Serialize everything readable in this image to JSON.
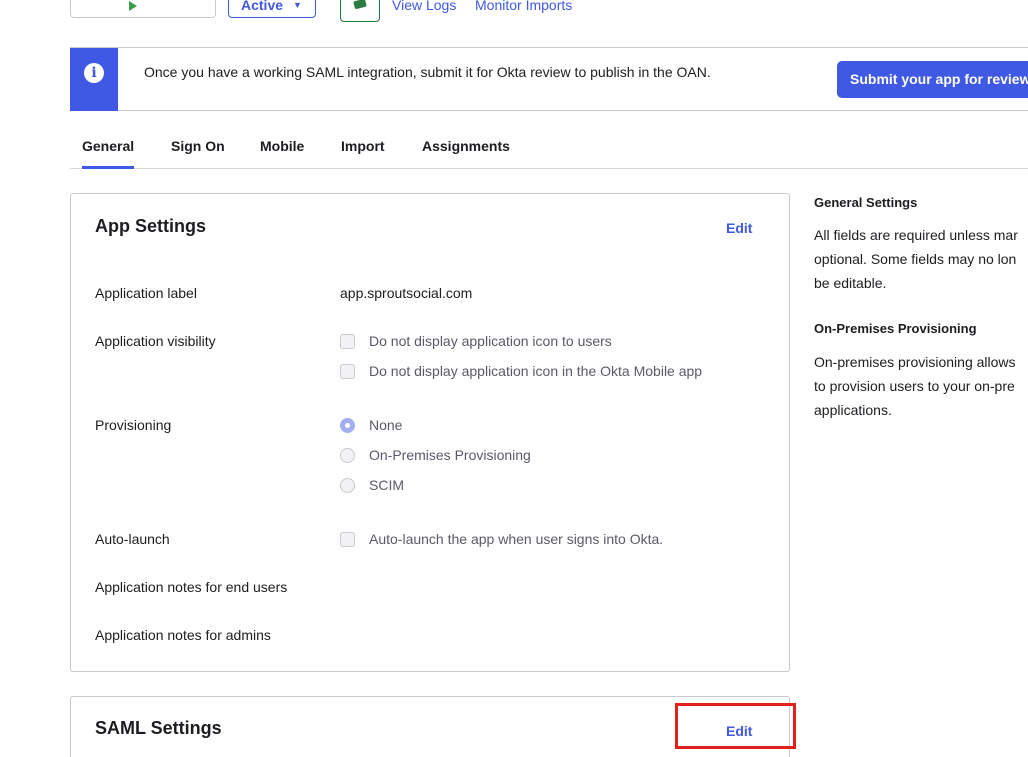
{
  "toolbar": {
    "status_label": "Active",
    "view_logs": "View Logs",
    "monitor_imports": "Monitor Imports"
  },
  "banner": {
    "message": "Once you have a working SAML integration, submit it for Okta review to publish in the OAN.",
    "button": "Submit your app for review"
  },
  "tabs": [
    {
      "label": "General",
      "active": true
    },
    {
      "label": "Sign On",
      "active": false
    },
    {
      "label": "Mobile",
      "active": false
    },
    {
      "label": "Import",
      "active": false
    },
    {
      "label": "Assignments",
      "active": false
    }
  ],
  "app_settings": {
    "title": "App Settings",
    "edit": "Edit",
    "rows": {
      "label": {
        "name": "Application label",
        "value": "app.sproutsocial.com"
      },
      "visibility": {
        "name": "Application visibility",
        "options": [
          "Do not display application icon to users",
          "Do not display application icon in the Okta Mobile app"
        ]
      },
      "provisioning": {
        "name": "Provisioning",
        "options": [
          "None",
          "On-Premises Provisioning",
          "SCIM"
        ],
        "selected": "None"
      },
      "auto_launch": {
        "name": "Auto-launch",
        "option": "Auto-launch the app when user signs into Okta."
      },
      "notes_end_users": {
        "name": "Application notes for end users"
      },
      "notes_admins": {
        "name": "Application notes for admins"
      }
    }
  },
  "saml_settings": {
    "title": "SAML Settings",
    "edit": "Edit"
  },
  "help": {
    "general_title": "General Settings",
    "general_text": "All fields are required unless mar\noptional. Some fields may no lon\nbe editable.",
    "onprem_title": "On-Premises Provisioning",
    "onprem_text": "On-premises provisioning allows\nto provision users to your on-pre\napplications."
  },
  "colors": {
    "accent": "#3f59e4",
    "highlight": "#e3201b"
  }
}
